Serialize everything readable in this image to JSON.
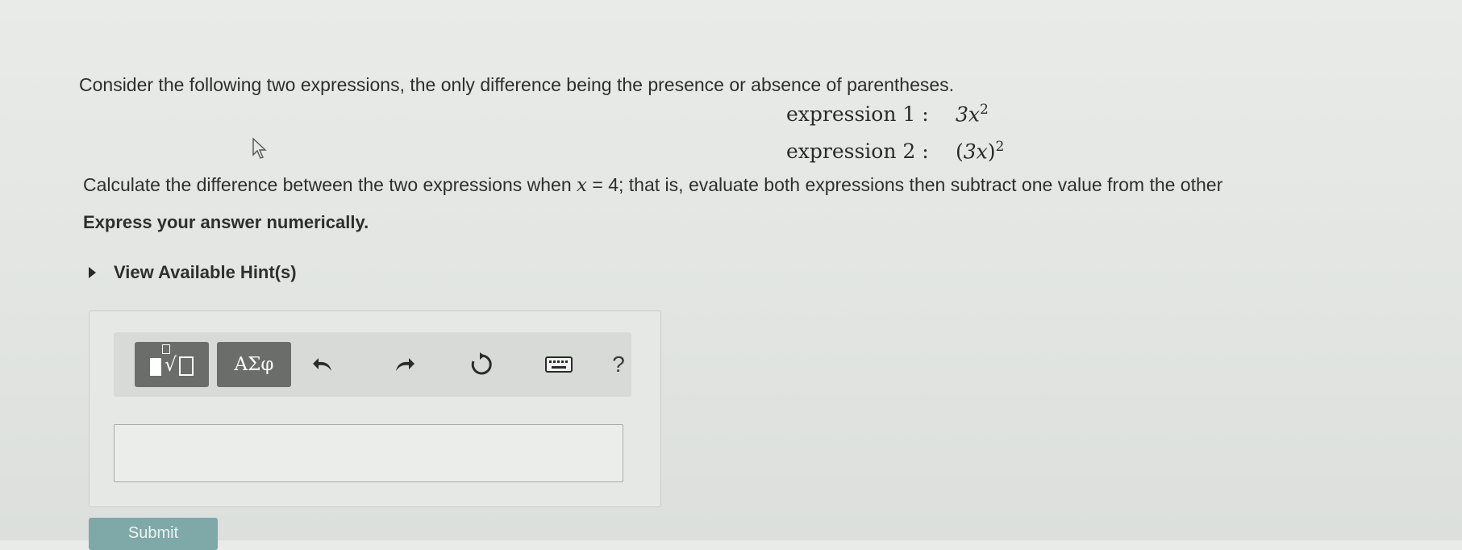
{
  "question": {
    "intro": "Consider the following two expressions, the only difference being the presence or absence of parentheses.",
    "expression1": {
      "label": "expression 1 :",
      "base": "3x",
      "exponent": "2"
    },
    "expression2": {
      "label": "expression 2 :",
      "open": "(",
      "inner": "3x",
      "close": ")",
      "exponent": "2"
    },
    "calc_before": "Calculate the difference between the two expressions when ",
    "calc_var": "x",
    "calc_eq": " = 4",
    "calc_after": "; that is, evaluate both expressions then subtract one value from the other",
    "express_instruction": "Express your answer numerically."
  },
  "hint": {
    "label": "View Available Hint(s)",
    "icon": "caret-right-icon"
  },
  "toolbar": {
    "templates_icon": "templates-icon",
    "symbols_label": "ΑΣφ",
    "undo_icon": "undo-icon",
    "redo_icon": "redo-icon",
    "reset_icon": "reset-icon",
    "keyboard_icon": "keyboard-icon",
    "help_label": "?"
  },
  "answer": {
    "value": "",
    "placeholder": ""
  },
  "submit": {
    "label": "Submit"
  },
  "colors": {
    "background": "#e5e8e5",
    "toolbar_button": "#6a6d6a",
    "submit_button": "#7fa9a8"
  }
}
